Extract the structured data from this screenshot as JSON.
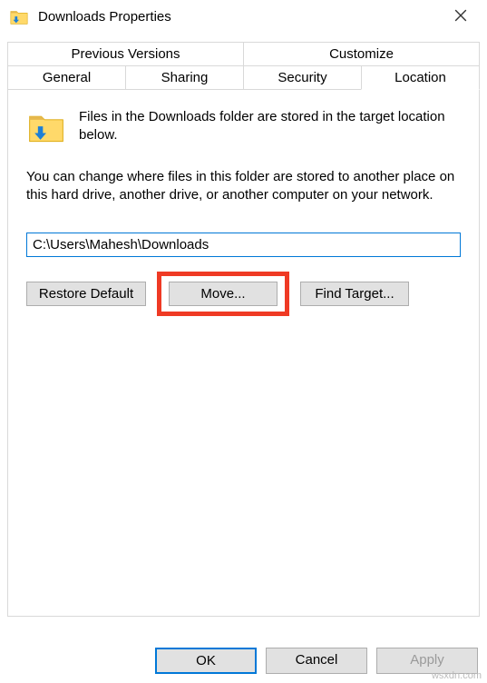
{
  "window": {
    "title": "Downloads Properties"
  },
  "tabs": {
    "row1": {
      "previous_versions": "Previous Versions",
      "customize": "Customize"
    },
    "row2": {
      "general": "General",
      "sharing": "Sharing",
      "security": "Security",
      "location": "Location"
    }
  },
  "panel": {
    "description1": "Files in the Downloads folder are stored in the target location below.",
    "description2": "You can change where files in this folder are stored to another place on this hard drive, another drive, or another computer on your network.",
    "path_value": "C:\\Users\\Mahesh\\Downloads",
    "restore_btn": "Restore Default",
    "move_btn": "Move...",
    "find_btn": "Find Target..."
  },
  "footer": {
    "ok": "OK",
    "cancel": "Cancel",
    "apply": "Apply"
  },
  "watermark": "wsxdn.com"
}
